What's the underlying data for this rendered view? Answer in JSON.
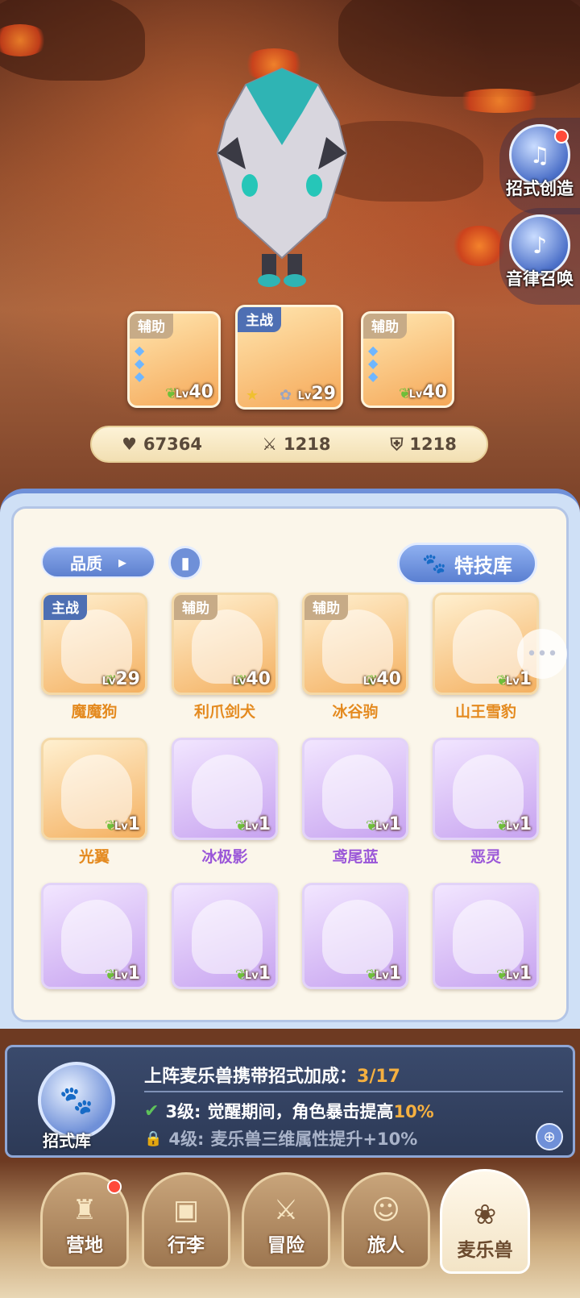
{
  "side_buttons": [
    {
      "label": "招式创造",
      "icon": "music-book-icon",
      "has_dot": true
    },
    {
      "label": "音律召唤",
      "icon": "lyre-icon",
      "has_dot": false
    }
  ],
  "team": [
    {
      "role": "辅助",
      "level": "40",
      "type": "support"
    },
    {
      "role": "主战",
      "level": "29",
      "type": "main"
    },
    {
      "role": "辅助",
      "level": "40",
      "type": "support"
    }
  ],
  "stats": {
    "hp": "67364",
    "attack": "1218",
    "defense": "1218"
  },
  "filters": {
    "quality_label": "品质",
    "skill_library_label": "特技库"
  },
  "beasts": [
    {
      "name": "魔魔狗",
      "level": "29",
      "tag": "主战",
      "rarity": "orange"
    },
    {
      "name": "利爪剑犬",
      "level": "40",
      "tag": "辅助",
      "rarity": "orange"
    },
    {
      "name": "冰谷驹",
      "level": "40",
      "tag": "辅助",
      "rarity": "orange"
    },
    {
      "name": "山王雪豹",
      "level": "1",
      "tag": "",
      "rarity": "orange"
    },
    {
      "name": "光翼",
      "level": "1",
      "tag": "",
      "rarity": "orange"
    },
    {
      "name": "冰极影",
      "level": "1",
      "tag": "",
      "rarity": "purple"
    },
    {
      "name": "鸢尾蓝",
      "level": "1",
      "tag": "",
      "rarity": "purple"
    },
    {
      "name": "恶灵",
      "level": "1",
      "tag": "",
      "rarity": "purple"
    },
    {
      "name": "",
      "level": "1",
      "tag": "",
      "rarity": "purple"
    },
    {
      "name": "",
      "level": "1",
      "tag": "",
      "rarity": "purple"
    },
    {
      "name": "",
      "level": "1",
      "tag": "",
      "rarity": "purple"
    },
    {
      "name": "",
      "level": "1",
      "tag": "",
      "rarity": "purple"
    }
  ],
  "bonus": {
    "icon_label": "招式库",
    "title": "上阵麦乐兽携带招式加成：",
    "count": "3/17",
    "line1_level": "3级:",
    "line1_text": "觉醒期间，角色暴击提高",
    "line1_pct": "10%",
    "line2_level": "4级:",
    "line2_text": "麦乐兽三维属性提升+10%"
  },
  "nav": [
    {
      "label": "营地",
      "icon": "castle-icon",
      "has_dot": true,
      "active": false
    },
    {
      "label": "行李",
      "icon": "backpack-icon",
      "has_dot": false,
      "active": false
    },
    {
      "label": "冒险",
      "icon": "swords-icon",
      "has_dot": false,
      "active": false
    },
    {
      "label": "旅人",
      "icon": "traveler-icon",
      "has_dot": false,
      "active": false
    },
    {
      "label": "麦乐兽",
      "icon": "beast-icon",
      "has_dot": false,
      "active": true
    }
  ]
}
